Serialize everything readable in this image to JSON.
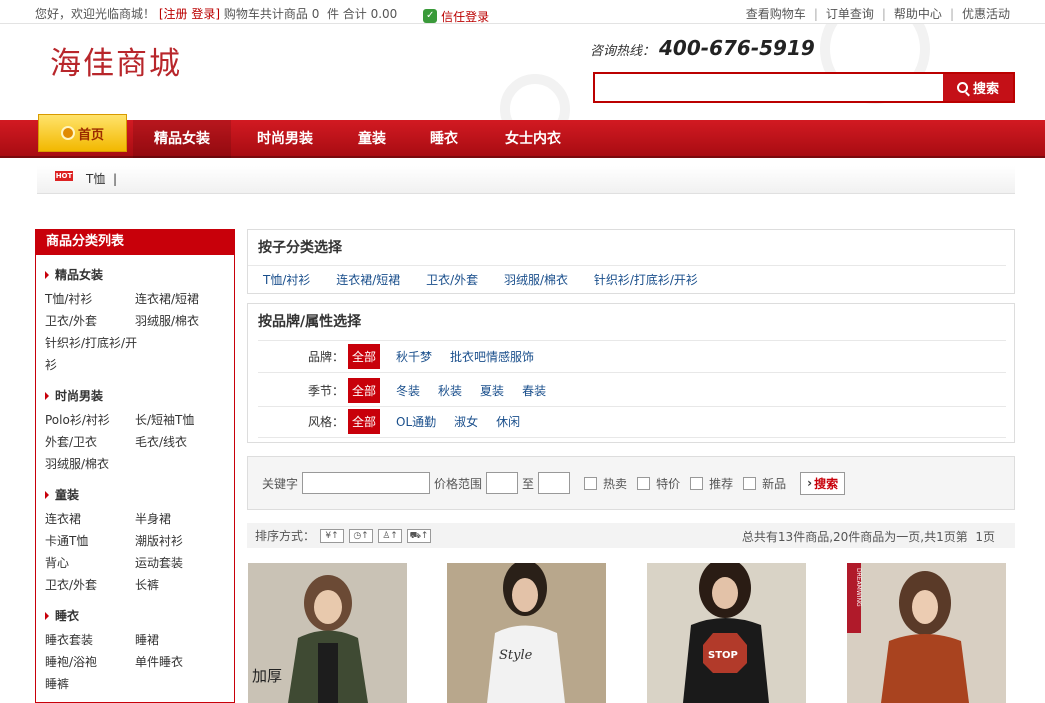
{
  "topbar": {
    "welcome": "您好，欢迎光临商城！",
    "register": "[注册",
    "login": "登录]",
    "cart_summary": "购物车共计商品 0  件 合计 0.00",
    "trust_login": "信任登录",
    "links": [
      "查看购物车",
      "订单查询",
      "帮助中心",
      "优惠活动"
    ]
  },
  "header": {
    "logo": "海佳商城",
    "hotline_label": "咨询热线：",
    "hotline_number": "400-676-5919",
    "search_value": "",
    "search_button": "搜索"
  },
  "nav": {
    "home": "首页",
    "items": [
      "精品女装",
      "时尚男装",
      "童装",
      "睡衣",
      "女士内衣"
    ]
  },
  "breadcrumb": {
    "text": "T恤  |"
  },
  "sidebar": {
    "title": "商品分类列表",
    "categories": [
      {
        "name": "精品女装",
        "items": [
          "T恤/衬衫",
          "连衣裙/短裙",
          "卫衣/外套",
          "羽绒服/棉衣",
          "针织衫/打底衫/开衫"
        ]
      },
      {
        "name": "时尚男装",
        "items": [
          "Polo衫/衬衫",
          "长/短袖T恤",
          "外套/卫衣",
          "毛衣/线衣",
          "羽绒服/棉衣"
        ]
      },
      {
        "name": "童装",
        "items": [
          "连衣裙",
          "半身裙",
          "卡通T恤",
          "潮版衬衫",
          "背心",
          "运动套装",
          "卫衣/外套",
          "长裤"
        ]
      },
      {
        "name": "睡衣",
        "items": [
          "睡衣套装",
          "睡裙",
          "睡袍/浴袍",
          "单件睡衣",
          "睡裤"
        ]
      }
    ]
  },
  "subcat": {
    "title": "按子分类选择",
    "items": [
      "T恤/衬衫",
      "连衣裙/短裙",
      "卫衣/外套",
      "羽绒服/棉衣",
      "针织衫/打底衫/开衫"
    ]
  },
  "brand": {
    "title": "按品牌/属性选择",
    "rows": [
      {
        "label": "品牌：",
        "all": "全部",
        "values": [
          "秋千梦",
          "批衣吧情感服饰"
        ]
      },
      {
        "label": "季节：",
        "all": "全部",
        "values": [
          "冬装",
          "秋装",
          "夏装",
          "春装"
        ]
      },
      {
        "label": "风格：",
        "all": "全部",
        "values": [
          "OL通勤",
          "淑女",
          "休闲"
        ]
      }
    ]
  },
  "filter": {
    "keyword_label": "关键字",
    "price_label": "价格范围",
    "to": "至",
    "checks": [
      "热卖",
      "特价",
      "推荐",
      "新品"
    ],
    "button": "搜索"
  },
  "sort": {
    "label": "排序方式：",
    "summary": "总共有13件商品,20件商品为一页,共1页第  1页"
  },
  "products": [
    {
      "colors": [
        "#3f4a33",
        "#6b6450",
        "#c9c2b5"
      ],
      "caption": "加厚"
    },
    {
      "colors": [
        "#f2f2f2",
        "#7a6a55",
        "#b8a78c"
      ],
      "caption": "Style"
    },
    {
      "colors": [
        "#1a1a1a",
        "#b23a2a",
        "#d9d3c6"
      ],
      "caption": "STOP"
    },
    {
      "colors": [
        "#a9431f",
        "#5a3a28",
        "#d8cfc2"
      ],
      "caption": "DREAMWING"
    }
  ]
}
